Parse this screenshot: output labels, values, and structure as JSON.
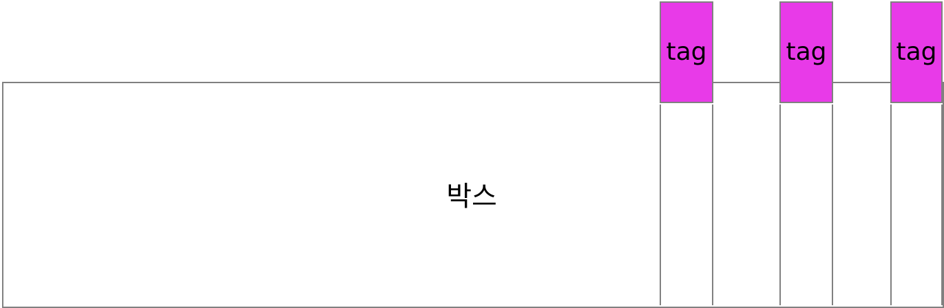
{
  "box": {
    "label": "박스"
  },
  "tags": [
    {
      "label": "tag"
    },
    {
      "label": "tag"
    },
    {
      "label": "tag"
    }
  ],
  "colors": {
    "tag_fill": "#e83ae8",
    "border": "#808080",
    "background": "#ffffff"
  }
}
